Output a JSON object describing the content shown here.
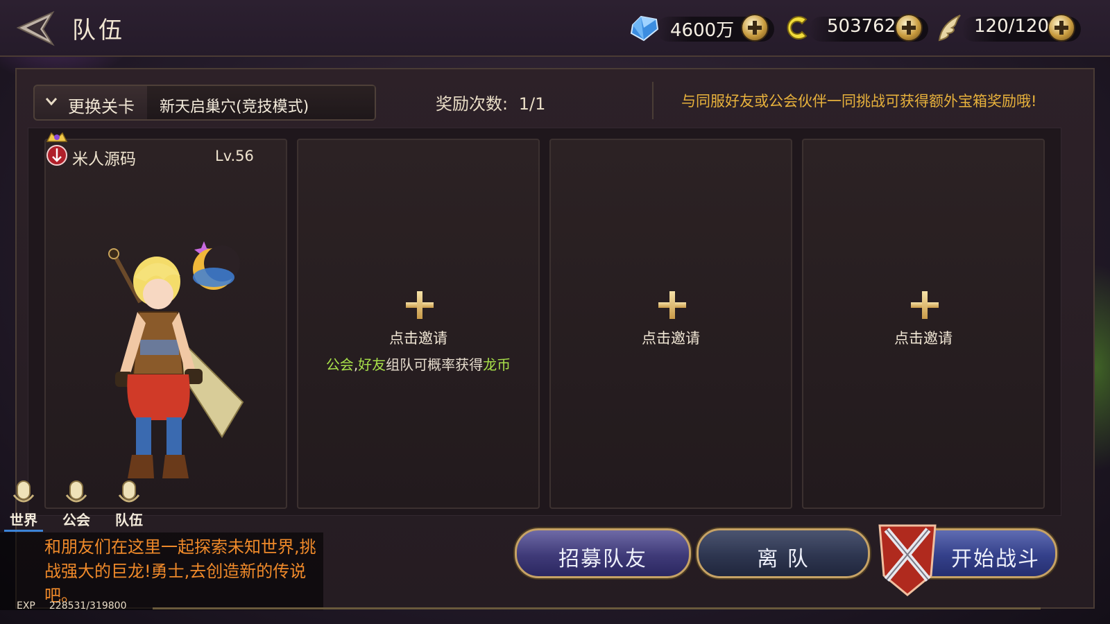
{
  "header": {
    "title": "队伍"
  },
  "resources": [
    {
      "icon": "diamond-icon",
      "value": "4600万"
    },
    {
      "icon": "gold-coin-icon",
      "value": "503762"
    },
    {
      "icon": "stamina-wing-icon",
      "value": "120/120"
    }
  ],
  "stage": {
    "change_label": "更换关卡",
    "current": "新天启巢穴(竞技模式)"
  },
  "reward": {
    "label": "奖励次数:",
    "value": "1/1"
  },
  "hint": "与同服好友或公会伙伴一同挑战可获得额外宝箱奖励哦!",
  "host": {
    "name": "米人源码",
    "level": "Lv.56"
  },
  "slots": [
    {
      "invite": "点击邀请",
      "bonus": {
        "guild": "公会",
        "sep": ",",
        "friend": "好友",
        "mid": "组队可概率获得",
        "reward": "龙币"
      }
    },
    {
      "invite": "点击邀请"
    },
    {
      "invite": "点击邀请"
    }
  ],
  "chat": {
    "channels": [
      "世界",
      "公会",
      "队伍"
    ],
    "active_channel": "世界",
    "message": "和朋友们在这里一起探索未知世界,挑战强大的巨龙!勇士,去创造新的传说吧。"
  },
  "exp": {
    "label": "EXP",
    "value": "228531/319800"
  },
  "buttons": {
    "recruit": "招募队友",
    "leave": "离 队",
    "start": "开始战斗"
  },
  "colors": {
    "hint": "#e8b23c",
    "bonus_highlight": "#a8e04a",
    "chat_text": "#f08a2a",
    "gold": "#c89b3e"
  }
}
